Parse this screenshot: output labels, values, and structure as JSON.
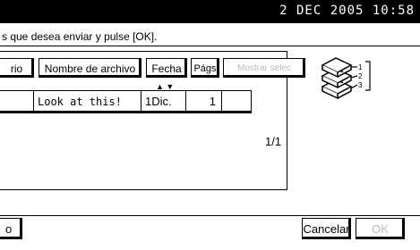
{
  "header": {
    "datetime": "2 DEC  2005 10:58"
  },
  "message": "s que desea enviar y pulse [OK].",
  "columns": {
    "col0": "rio",
    "col1": "Nombre de archivo",
    "col2": "Fecha",
    "col3": "Págs",
    "col4": "Mostrar selec"
  },
  "sort_indicator": "▲ ▼",
  "row": {
    "filename": "Look at this!",
    "date": "1Dic.",
    "pages": "1"
  },
  "pagination": "1/1",
  "side_icon": {
    "labels": [
      "1",
      "2",
      "3"
    ]
  },
  "bottom": {
    "left_button": "o",
    "cancel": "Cancelar",
    "ok": "OK"
  }
}
